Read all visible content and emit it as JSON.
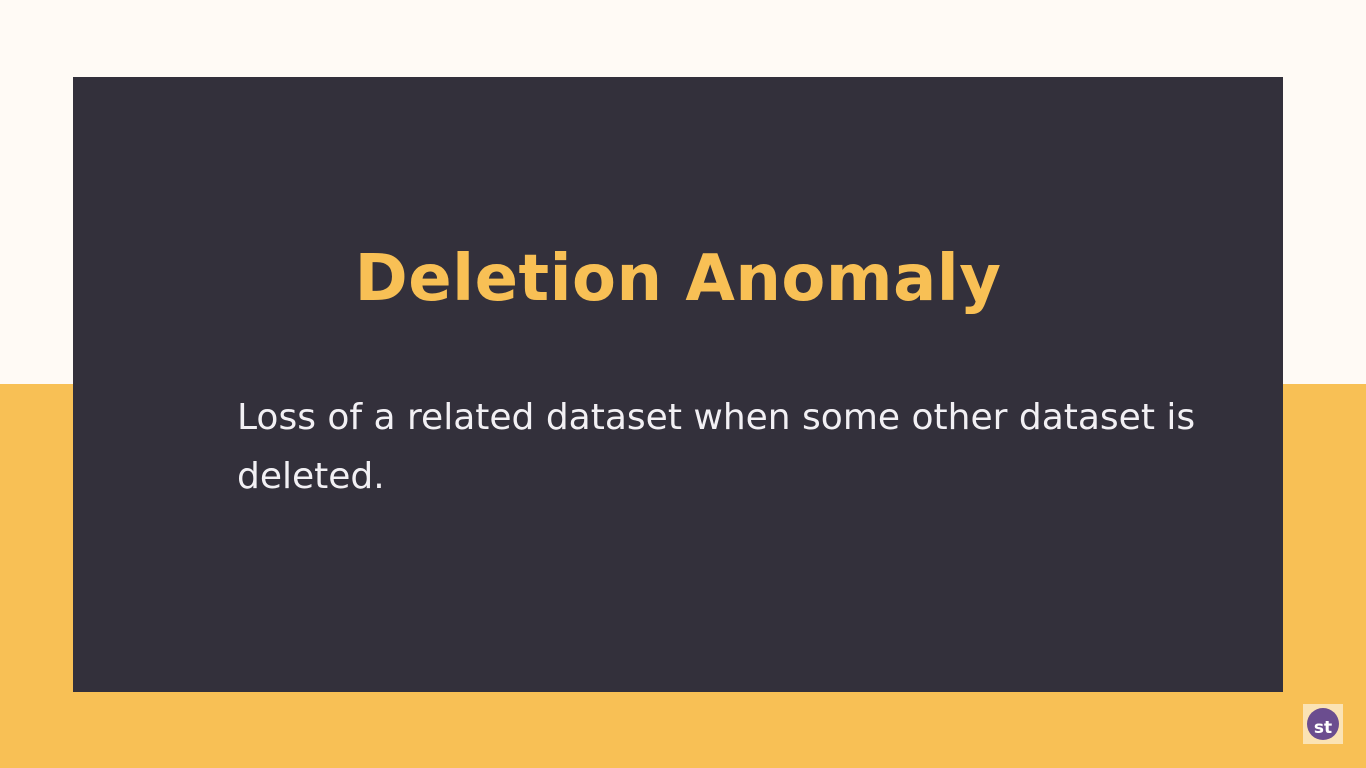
{
  "slide": {
    "title": "Deletion Anomaly",
    "body": "Loss of a related dataset when some other dataset is deleted."
  },
  "logo": {
    "text": "st"
  },
  "colors": {
    "accent": "#f8c055",
    "card": "#33303b",
    "top_background": "#fffaf5",
    "logo_circle": "#6b4d8f"
  }
}
